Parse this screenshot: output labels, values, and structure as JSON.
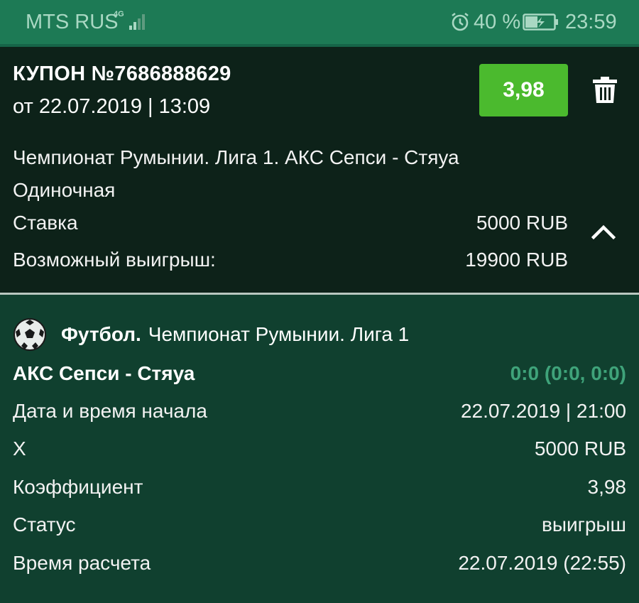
{
  "status_bar": {
    "carrier": "MTS RUS",
    "network": "4G",
    "battery_percent": "40 %",
    "time": "23:59"
  },
  "coupon": {
    "title": "КУПОН №7686888629",
    "date": "от 22.07.2019 | 13:09",
    "odds": "3,98",
    "match": "Чемпионат Румынии. Лига 1. АКС Сепси - Стяуа",
    "bet_type": "Одиночная",
    "stake_label": "Ставка",
    "stake_value": "5000 RUB",
    "win_label": "Возможный выигрыш:",
    "win_value": "19900 RUB"
  },
  "details": {
    "sport": "Футбол.",
    "league": "Чемпионат Румынии. Лига 1",
    "rows": [
      {
        "label": "АКС Сепси - Стяуа",
        "value": "0:0 (0:0, 0:0)"
      },
      {
        "label": "Дата и время начала",
        "value": "22.07.2019 | 21:00"
      },
      {
        "label": "X",
        "value": "5000 RUB"
      },
      {
        "label": "Коэффициент",
        "value": "3,98"
      },
      {
        "label": "Статус",
        "value": "выигрыш"
      },
      {
        "label": "Время расчета",
        "value": "22.07.2019 (22:55)"
      }
    ]
  },
  "colors": {
    "odds_button": "#4bba2e",
    "status_bar": "#1d7a55",
    "coupon_bg": "#0d2219",
    "details_bg": "#10402f",
    "score": "#3fa37a"
  },
  "icons": [
    "signal-icon",
    "alarm-icon",
    "battery-charging-icon",
    "trash-icon",
    "chevron-up-icon",
    "soccer-ball-icon"
  ]
}
